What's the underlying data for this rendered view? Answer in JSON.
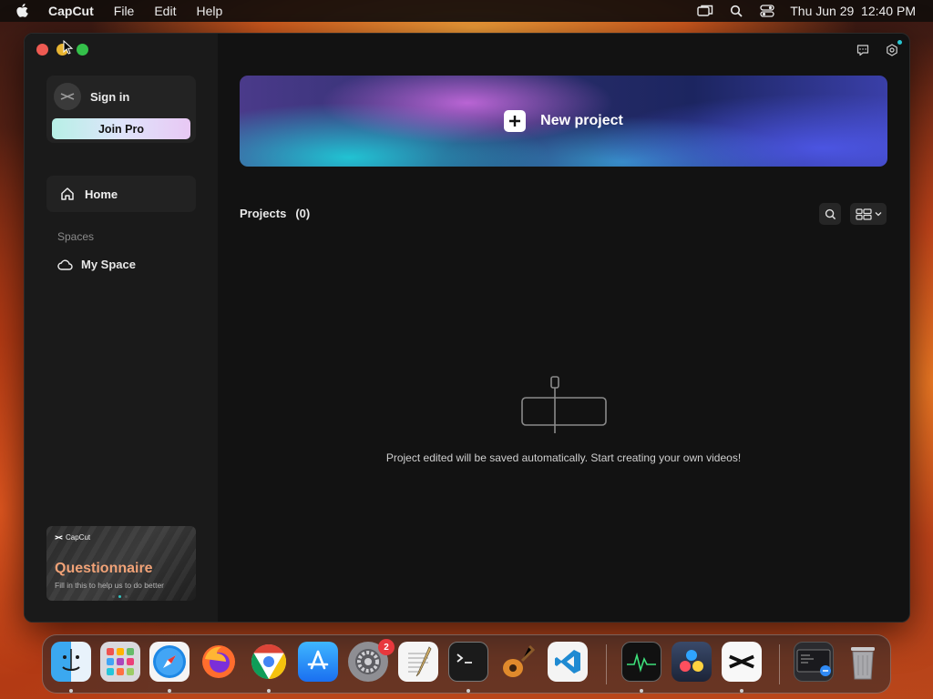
{
  "menubar": {
    "app_name": "CapCut",
    "menus": [
      "File",
      "Edit",
      "Help"
    ],
    "datetime": "Thu Jun 29  12:40 PM",
    "status_icons": [
      "screen-mirror-icon",
      "spotlight-search-icon",
      "control-center-icon"
    ]
  },
  "window": {
    "sidebar": {
      "signin_label": "Sign in",
      "join_pro_label": "Join Pro",
      "home_label": "Home",
      "spaces_title": "Spaces",
      "my_space_label": "My Space",
      "promo": {
        "brand": "CapCut",
        "title": "Questionnaire",
        "subtitle": "Fill in this to help us to do better"
      }
    },
    "main": {
      "new_project_label": "New project",
      "projects_title": "Projects",
      "projects_count": "(0)",
      "empty_message": "Project edited will be saved automatically. Start creating your own videos!"
    }
  },
  "dock": {
    "apps": [
      "Finder",
      "Launchpad",
      "Safari",
      "Firefox",
      "Google Chrome",
      "App Store",
      "System Settings",
      "TextEdit",
      "Terminal",
      "GarageBand",
      "Visual Studio Code",
      "Activity Monitor",
      "DaVinci Resolve",
      "CapCut",
      "Screenshot",
      "Trash"
    ],
    "system_settings_badge": "2"
  },
  "colors": {
    "accent_cyan": "#31c6c4",
    "window_bg": "#121212",
    "sidebar_bg": "#1a1a1a",
    "close_red": "#ee5a52",
    "minimize_yellow": "#e8b431",
    "zoom_green": "#34c04a"
  }
}
